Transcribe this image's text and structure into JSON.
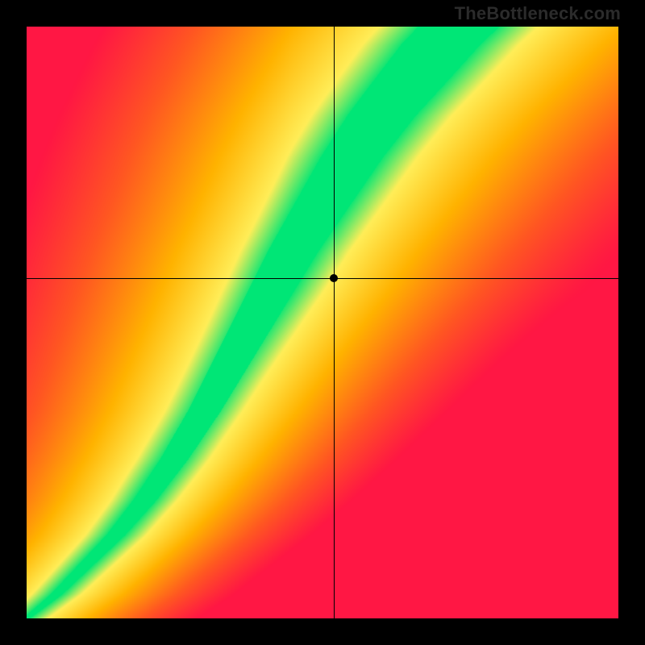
{
  "watermark": "TheBottleneck.com",
  "chart_data": {
    "type": "heatmap",
    "title": "",
    "xlabel": "",
    "ylabel": "",
    "xlim": [
      0,
      1
    ],
    "ylim": [
      0,
      1
    ],
    "description": "Compatibility heatmap with optimal diagonal ridge (green) and gradient from red (poor) through orange/yellow to green (ideal).",
    "marker": {
      "x": 0.52,
      "y": 0.575
    },
    "crosshair": {
      "x": 0.52,
      "y": 0.575
    },
    "color_stops": {
      "worst": "#ff1744",
      "bad": "#ff5722",
      "mid": "#ffb300",
      "near": "#ffee58",
      "best": "#00e676"
    },
    "ridge_points": [
      {
        "x": 0.0,
        "y": 0.0,
        "half_width": 0.006
      },
      {
        "x": 0.05,
        "y": 0.04,
        "half_width": 0.01
      },
      {
        "x": 0.1,
        "y": 0.09,
        "half_width": 0.013
      },
      {
        "x": 0.15,
        "y": 0.14,
        "half_width": 0.016
      },
      {
        "x": 0.2,
        "y": 0.2,
        "half_width": 0.02
      },
      {
        "x": 0.25,
        "y": 0.27,
        "half_width": 0.024
      },
      {
        "x": 0.3,
        "y": 0.35,
        "half_width": 0.028
      },
      {
        "x": 0.35,
        "y": 0.44,
        "half_width": 0.033
      },
      {
        "x": 0.4,
        "y": 0.53,
        "half_width": 0.038
      },
      {
        "x": 0.45,
        "y": 0.62,
        "half_width": 0.043
      },
      {
        "x": 0.5,
        "y": 0.7,
        "half_width": 0.048
      },
      {
        "x": 0.55,
        "y": 0.78,
        "half_width": 0.053
      },
      {
        "x": 0.6,
        "y": 0.85,
        "half_width": 0.058
      },
      {
        "x": 0.65,
        "y": 0.91,
        "half_width": 0.063
      },
      {
        "x": 0.7,
        "y": 0.97,
        "half_width": 0.067
      },
      {
        "x": 0.75,
        "y": 1.02,
        "half_width": 0.07
      }
    ]
  }
}
